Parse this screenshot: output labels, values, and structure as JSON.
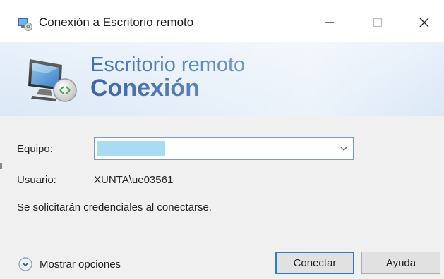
{
  "window": {
    "title": "Conexión a Escritorio remoto",
    "controls": {
      "minimize": "minimize-icon",
      "maximize": "maximize-icon",
      "close": "close-icon"
    }
  },
  "banner": {
    "line1": "Escritorio remoto",
    "line2": "Conexión"
  },
  "form": {
    "equipo_label": "Equipo:",
    "equipo_value": "",
    "usuario_label": "Usuario:",
    "usuario_value": "XUNTA\\ue03561",
    "notice": "Se solicitarán credenciales al conectarse."
  },
  "footer": {
    "options_label": "Mostrar opciones",
    "connect_label": "Conectar",
    "help_label": "Ayuda"
  },
  "colors": {
    "accent": "#1d5fae",
    "selection": "#a8dcf2",
    "default_button_border": "#2d7bd6"
  }
}
